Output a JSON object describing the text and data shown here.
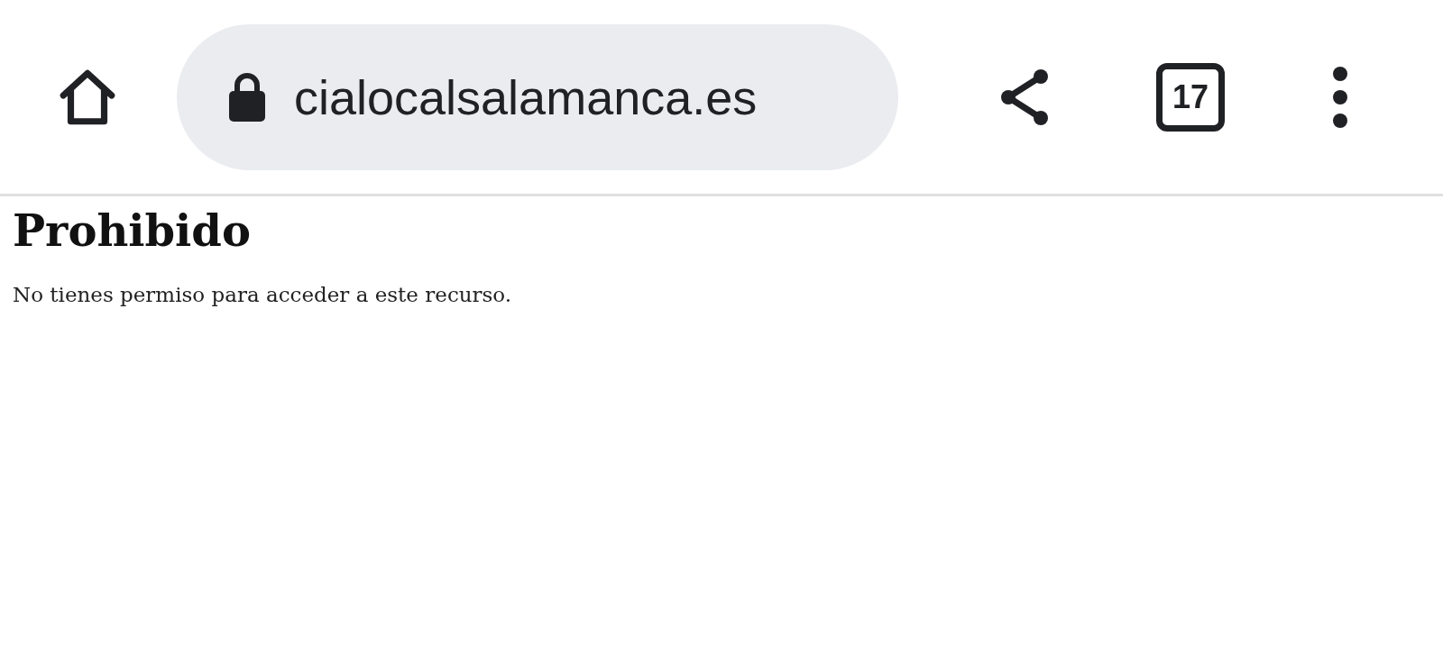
{
  "toolbar": {
    "url": "cialocalsalamanca.es",
    "secure": true,
    "tab_count": "17"
  },
  "page": {
    "heading": "Prohibido",
    "message": "No tienes permiso para acceder a este recurso."
  }
}
